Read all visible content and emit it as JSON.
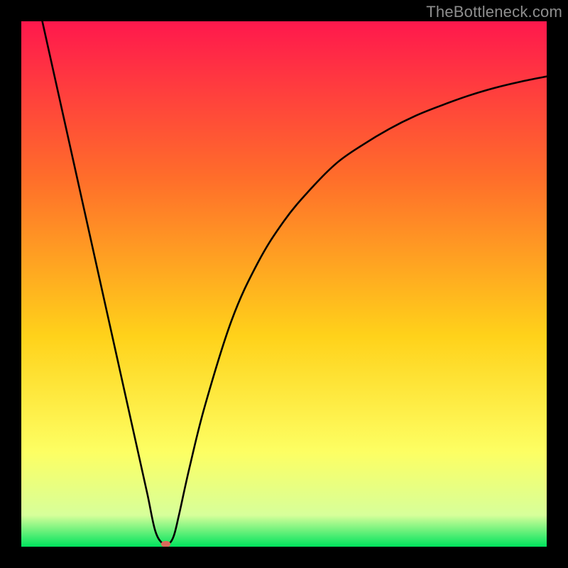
{
  "watermark": "TheBottleneck.com",
  "chart_data": {
    "type": "line",
    "title": "",
    "xlabel": "",
    "ylabel": "",
    "xlim": [
      0,
      100
    ],
    "ylim": [
      0,
      100
    ],
    "grid": false,
    "legend": false,
    "colors": {
      "gradient_top": "#ff184d",
      "gradient_upper_mid": "#ff6e2a",
      "gradient_mid": "#ffd21a",
      "gradient_lower_mid": "#fdff63",
      "gradient_low": "#d7ff9a",
      "gradient_bottom": "#00e35d",
      "curve": "#000000",
      "marker": "#d86a5a"
    },
    "series": [
      {
        "name": "curve",
        "x": [
          4,
          6,
          8,
          10,
          12,
          14,
          16,
          18,
          20,
          22,
          24,
          25.5,
          27,
          28,
          29,
          30,
          32,
          35,
          40,
          45,
          50,
          55,
          60,
          65,
          70,
          75,
          80,
          85,
          90,
          95,
          100
        ],
        "y": [
          100,
          91,
          82,
          73,
          64,
          55,
          46,
          37,
          28,
          19,
          10,
          3,
          0.5,
          0.5,
          2,
          6,
          15,
          27,
          43,
          54,
          62,
          68,
          73,
          76.5,
          79.5,
          82,
          84,
          85.8,
          87.3,
          88.5,
          89.5
        ]
      }
    ],
    "marker": {
      "x": 27.5,
      "y": 0.5,
      "rx": 0.9,
      "ry": 0.6
    },
    "annotations": []
  }
}
